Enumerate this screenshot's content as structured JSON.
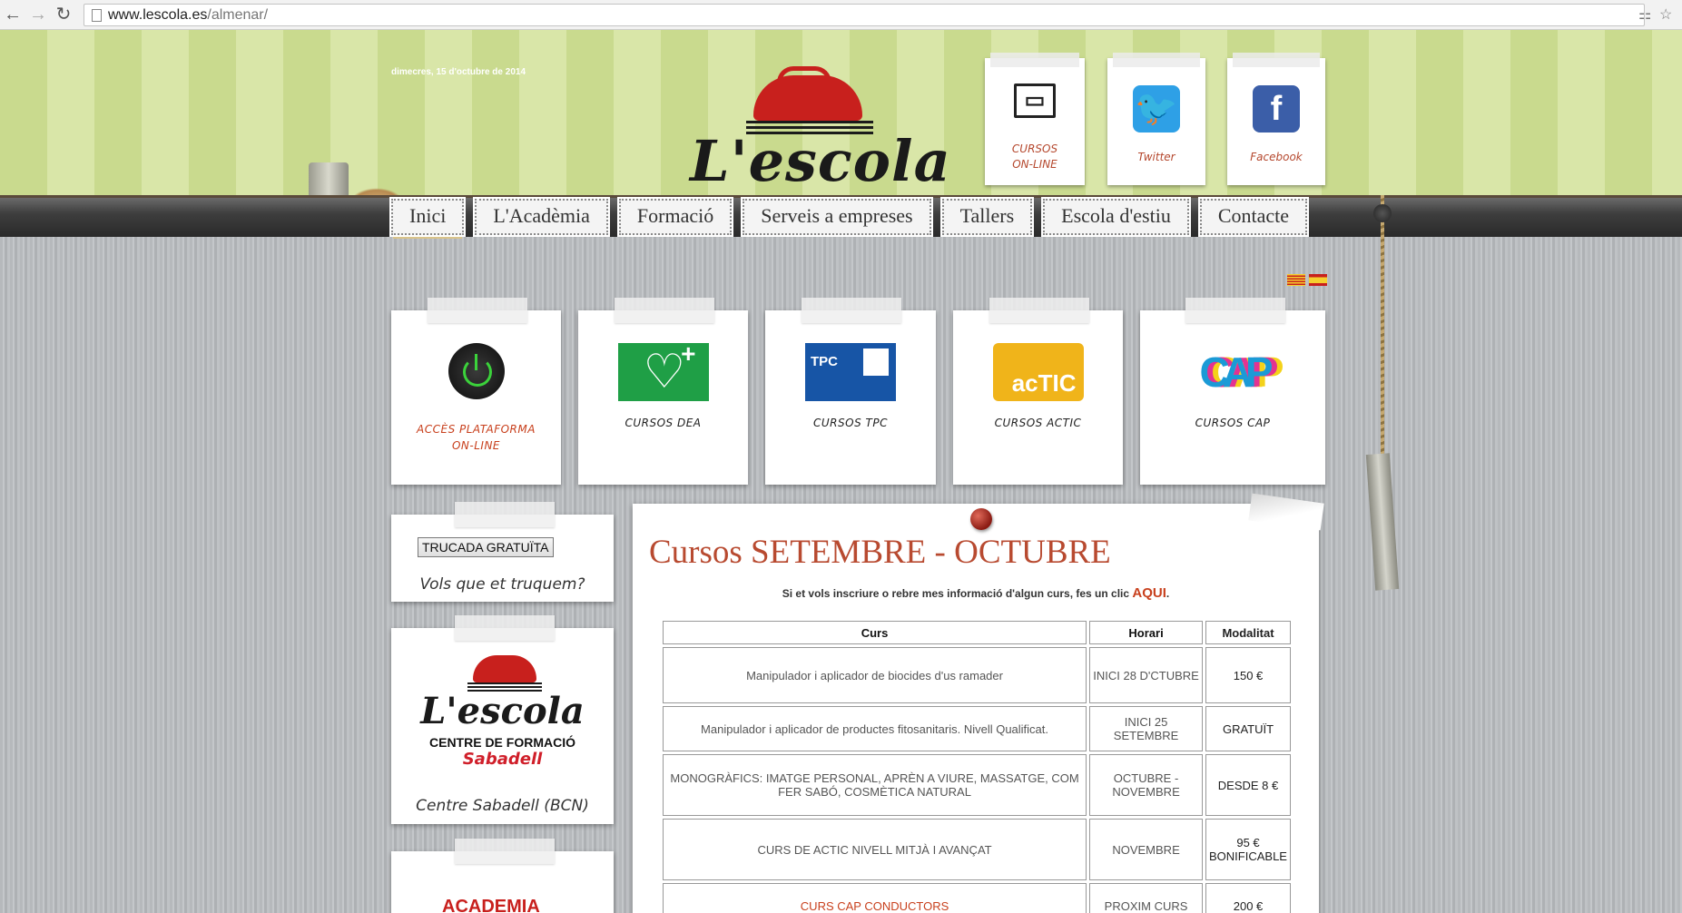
{
  "browser": {
    "url_host": "www.lescola.es",
    "url_path": "/almenar/"
  },
  "header": {
    "date": "dimecres, 15 d'octubre de 2014",
    "logo_text": "L'escola",
    "social": [
      {
        "label": "CURSOS ON-LINE",
        "icon": "presentation-icon"
      },
      {
        "label": "Twitter",
        "icon": "twitter-icon"
      },
      {
        "label": "Facebook",
        "icon": "facebook-icon"
      }
    ]
  },
  "menu": [
    "Inici",
    "L'Acadèmia",
    "Formació",
    "Serveis a empreses",
    "Tallers",
    "Escola d'estiu",
    "Contacte"
  ],
  "cards": [
    {
      "caption": "ACCÈS PLATAFORMA ON-LINE",
      "icon": "power-icon"
    },
    {
      "caption": "CURSOS DEA",
      "icon": "dea-icon"
    },
    {
      "caption": "CURSOS TPC",
      "icon": "tpc-icon",
      "logo_text": "TPC"
    },
    {
      "caption": "CURSOS ACTIC",
      "icon": "actic-icon",
      "logo_text": "acTIC"
    },
    {
      "caption": "CURSOS CAP",
      "icon": "cap-icon",
      "logo_text": "CAP"
    }
  ],
  "sidebar": {
    "call_button": "TRUCADA GRATUÏTA",
    "call_caption": "Vols que et truquem?",
    "sabadell_logo_text": "L'escola",
    "sabadell_sub": "CENTRE DE FORMACIÓ",
    "sabadell_city": "Sabadell",
    "sabadell_caption": "Centre Sabadell (BCN)",
    "academia_text": "ACADEMIA"
  },
  "main": {
    "title": "Cursos SETEMBRE - OCTUBRE",
    "intro": "Si et vols inscriure o rebre mes informació d'algun curs, fes un clic",
    "intro_link": "AQUI",
    "columns": [
      "Curs",
      "Horari",
      "Modalitat"
    ],
    "rows": [
      {
        "curs": "Manipulador i aplicador de biocides d'us ramader",
        "horari": "INICI 28 D'CTUBRE",
        "modalitat": "150 €"
      },
      {
        "curs": "Manipulador i aplicador de productes fitosanitaris. Nivell Qualificat.",
        "horari": "INICI 25 SETEMBRE",
        "modalitat": "GRATUÏT"
      },
      {
        "curs": "MONOGRÀFICS: IMATGE PERSONAL, APRÈN A VIURE, MASSATGE, COM FER SABÓ, COSMÈTICA NATURAL",
        "horari": "OCTUBRE - NOVEMBRE",
        "modalitat": "DESDE 8 €"
      },
      {
        "curs": "CURS DE ACTIC NIVELL MITJÀ I AVANÇAT",
        "horari": "NOVEMBRE",
        "modalitat": "95 € BONIFICABLE"
      },
      {
        "curs": "CURS CAP CONDUCTORS",
        "horari": "PROXIM CURS",
        "modalitat": "200 €"
      }
    ]
  }
}
